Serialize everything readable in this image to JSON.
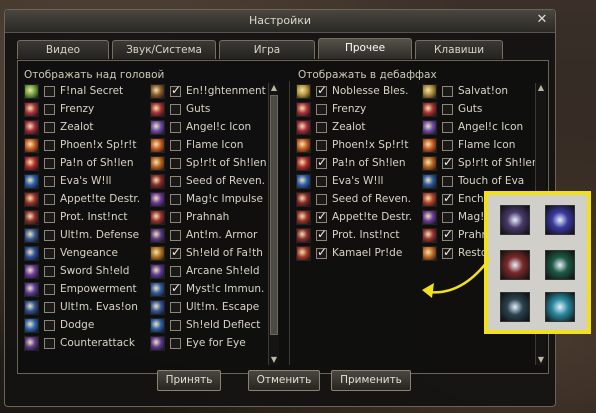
{
  "window": {
    "title": "Настройки"
  },
  "tabs": [
    {
      "label": "Видео",
      "active": false
    },
    {
      "label": "Звук/Система",
      "active": false
    },
    {
      "label": "Игра",
      "active": false
    },
    {
      "label": "Прочее",
      "active": true
    },
    {
      "label": "Клавиши",
      "active": false
    }
  ],
  "left_section": {
    "title": "Отображать над головой",
    "col1": [
      {
        "label": "F!nal Secret",
        "checked": false,
        "icon": "buff-icon-green",
        "color": "#6ea03a"
      },
      {
        "label": "Frenzy",
        "checked": false,
        "icon": "buff-icon-red",
        "color": "#a8323a"
      },
      {
        "label": "Zealot",
        "checked": false,
        "icon": "buff-icon-red",
        "color": "#a02a3c"
      },
      {
        "label": "Phoen!x Sp!r!t",
        "checked": false,
        "icon": "buff-icon-orange",
        "color": "#c45a1e"
      },
      {
        "label": "Pa!n of Sh!len",
        "checked": false,
        "icon": "buff-icon-red",
        "color": "#b32a2a"
      },
      {
        "label": "Eva's W!ll",
        "checked": false,
        "icon": "buff-icon-blue",
        "color": "#2a5fae"
      },
      {
        "label": "Appet!te Destr.",
        "checked": false,
        "icon": "buff-icon-red",
        "color": "#9a3228"
      },
      {
        "label": "Prot. Inst!nct",
        "checked": false,
        "icon": "buff-icon-red",
        "color": "#8c2e2e"
      },
      {
        "label": "Ult!m. Defense",
        "checked": false,
        "icon": "buff-icon-blue",
        "color": "#3a5a96"
      },
      {
        "label": "Vengeance",
        "checked": false,
        "icon": "buff-icon-blue",
        "color": "#2a4fa0"
      },
      {
        "label": "Sword Sh!eld",
        "checked": false,
        "icon": "buff-icon-purple",
        "color": "#6a3aa0"
      },
      {
        "label": "Empowerment",
        "checked": false,
        "icon": "buff-icon-purple",
        "color": "#5c3c9c"
      },
      {
        "label": "Ult!m. Evas!on",
        "checked": false,
        "icon": "buff-icon-blue",
        "color": "#30529a"
      },
      {
        "label": "Dodge",
        "checked": false,
        "icon": "buff-icon-blue",
        "color": "#2f63b0"
      },
      {
        "label": "Counterattack",
        "checked": false,
        "icon": "buff-icon-purple",
        "color": "#5a3a8a"
      }
    ],
    "col2": [
      {
        "label": "En!!ghtenment",
        "checked": true,
        "icon": "buff-icon-brown",
        "color": "#8a5a2a"
      },
      {
        "label": "Guts",
        "checked": false,
        "icon": "buff-icon-red",
        "color": "#a83030"
      },
      {
        "label": "Angel!c Icon",
        "checked": false,
        "icon": "buff-icon-purple",
        "color": "#6a4aa8"
      },
      {
        "label": "Flame Icon",
        "checked": false,
        "icon": "buff-icon-orange",
        "color": "#c65a20"
      },
      {
        "label": "Sp!r!t of Sh!len",
        "checked": false,
        "icon": "buff-icon-orange",
        "color": "#b8601e"
      },
      {
        "label": "Seed of Reven.",
        "checked": false,
        "icon": "buff-icon-red",
        "color": "#8a2a2a"
      },
      {
        "label": "Mag!c Impulse",
        "checked": false,
        "icon": "buff-icon-purple",
        "color": "#6a3a9a"
      },
      {
        "label": "Prahnah",
        "checked": false,
        "icon": "buff-icon-red",
        "color": "#9a3030"
      },
      {
        "label": "Ant!m. Armor",
        "checked": false,
        "icon": "buff-icon-purple",
        "color": "#5a3a88"
      },
      {
        "label": "Sh!eld of Fa!th",
        "checked": true,
        "icon": "buff-icon-orange",
        "color": "#b0701e"
      },
      {
        "label": "Arcane Sh!eld",
        "checked": false,
        "icon": "buff-icon-purple",
        "color": "#5d3a96"
      },
      {
        "label": "Myst!c Immun.",
        "checked": true,
        "icon": "buff-icon-blue",
        "color": "#2f5aa6"
      },
      {
        "label": "Ult!m. Escape",
        "checked": false,
        "icon": "buff-icon-blue",
        "color": "#3556a0"
      },
      {
        "label": "Sh!eld Deflect",
        "checked": false,
        "icon": "buff-icon-blue",
        "color": "#2c60a8"
      },
      {
        "label": "Eye for Eye",
        "checked": false,
        "icon": "buff-icon-purple",
        "color": "#5e3890"
      }
    ]
  },
  "right_section": {
    "title": "Отображать в дебаффах",
    "col1": [
      {
        "label": "Noblesse Bles.",
        "checked": true,
        "icon": "buff-icon-gold",
        "color": "#b8963a"
      },
      {
        "label": "Frenzy",
        "checked": false,
        "icon": "buff-icon-red",
        "color": "#a8323a"
      },
      {
        "label": "Zealot",
        "checked": false,
        "icon": "buff-icon-red",
        "color": "#a02a3c"
      },
      {
        "label": "Phoen!x Sp!r!t",
        "checked": false,
        "icon": "buff-icon-orange",
        "color": "#c45a1e"
      },
      {
        "label": "Pa!n of Sh!len",
        "checked": true,
        "icon": "buff-icon-red",
        "color": "#b32a2a"
      },
      {
        "label": "Eva's W!ll",
        "checked": false,
        "icon": "buff-icon-blue",
        "color": "#2a5fae"
      },
      {
        "label": "Seed of Reven.",
        "checked": false,
        "icon": "buff-icon-red",
        "color": "#8a2a2a"
      },
      {
        "label": "Appet!te Destr.",
        "checked": true,
        "icon": "buff-icon-red",
        "color": "#9a3228"
      },
      {
        "label": "Prot. Inst!nct",
        "checked": true,
        "icon": "buff-icon-red",
        "color": "#8c2e2e"
      },
      {
        "label": "Kamael Pr!de",
        "checked": true,
        "icon": "buff-icon-red",
        "color": "#a03a2a"
      }
    ],
    "col2": [
      {
        "label": "Salvat!on",
        "checked": false,
        "icon": "buff-icon-gold",
        "color": "#a88a3a"
      },
      {
        "label": "Guts",
        "checked": false,
        "icon": "buff-icon-red",
        "color": "#a83030"
      },
      {
        "label": "Angel!c Icon",
        "checked": false,
        "icon": "buff-icon-purple",
        "color": "#6a4aa8"
      },
      {
        "label": "Flame Icon",
        "checked": false,
        "icon": "buff-icon-orange",
        "color": "#c65a20"
      },
      {
        "label": "Sp!r!t of Sh!len",
        "checked": true,
        "icon": "buff-icon-orange",
        "color": "#b8601e"
      },
      {
        "label": "Touch of Eva",
        "checked": false,
        "icon": "buff-icon-blue",
        "color": "#2a5aa0"
      },
      {
        "label": "Ench.",
        "checked": true,
        "icon": "buff-icon-red",
        "color": "#b0402a"
      },
      {
        "label": "Mag!c",
        "checked": false,
        "icon": "buff-icon-purple",
        "color": "#6a3a9a"
      },
      {
        "label": "Prahn",
        "checked": true,
        "icon": "buff-icon-red",
        "color": "#9a3030"
      },
      {
        "label": "Restor",
        "checked": true,
        "icon": "buff-icon-orange",
        "color": "#c06a22"
      }
    ]
  },
  "buttons": {
    "accept": "Принять",
    "cancel": "Отменить",
    "apply": "Применить"
  },
  "popup_icons": [
    {
      "icon": "blade-icon",
      "color": "#4a3a6a"
    },
    {
      "icon": "crystal-icon",
      "color": "#3a3aa0"
    },
    {
      "icon": "banner-icon",
      "color": "#7a2a2a"
    },
    {
      "icon": "dragon-icon",
      "color": "#1e5a46"
    },
    {
      "icon": "wheel-icon",
      "color": "#2a4450"
    },
    {
      "icon": "rune-circle-icon",
      "color": "#2a8aa0"
    }
  ],
  "accent_colors": {
    "highlight_border": "#f0e020",
    "annotation_arrow": "#f0e020"
  }
}
